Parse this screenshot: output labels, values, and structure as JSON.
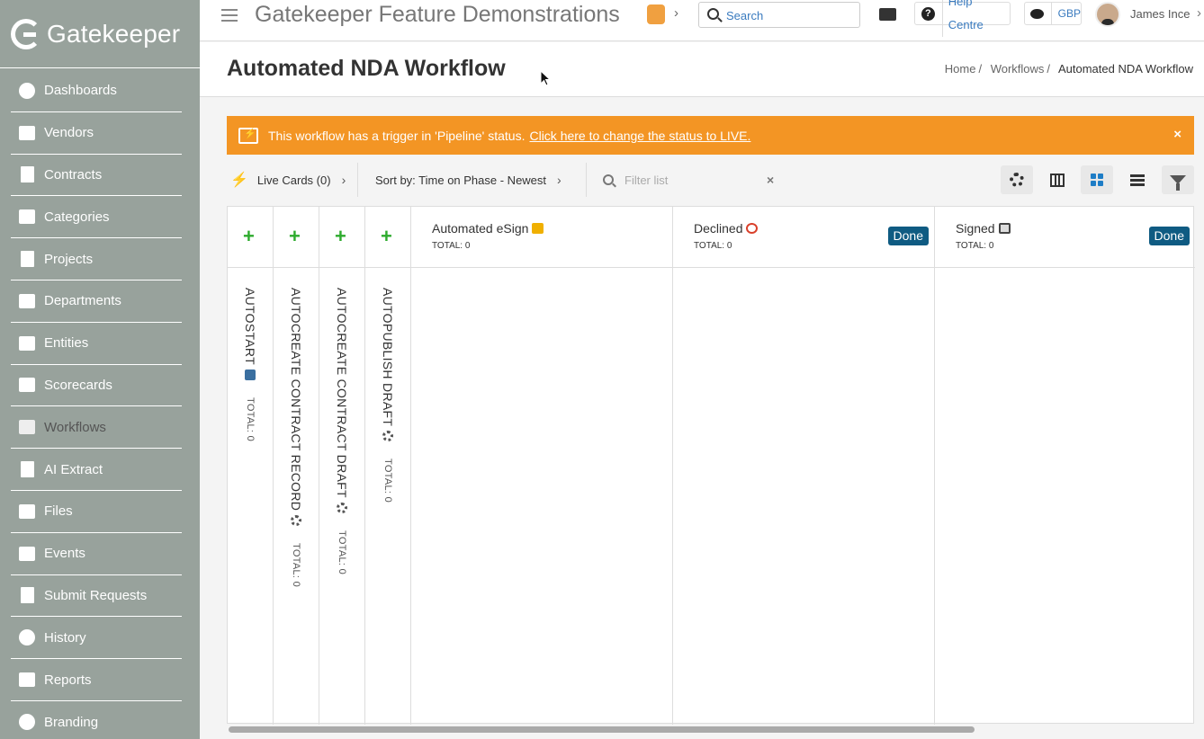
{
  "brand": {
    "name": "Gatekeeper"
  },
  "sidebar": {
    "items": [
      {
        "label": "Dashboards",
        "icon": "dashboard-icon"
      },
      {
        "label": "Vendors",
        "icon": "vendors-icon"
      },
      {
        "label": "Contracts",
        "icon": "contracts-icon"
      },
      {
        "label": "Categories",
        "icon": "categories-icon"
      },
      {
        "label": "Projects",
        "icon": "projects-icon"
      },
      {
        "label": "Departments",
        "icon": "departments-icon"
      },
      {
        "label": "Entities",
        "icon": "entities-icon"
      },
      {
        "label": "Scorecards",
        "icon": "scorecards-icon"
      },
      {
        "label": "Workflows",
        "icon": "workflows-icon"
      },
      {
        "label": "AI Extract",
        "icon": "ai-extract-icon"
      },
      {
        "label": "Files",
        "icon": "files-icon"
      },
      {
        "label": "Events",
        "icon": "events-icon"
      },
      {
        "label": "Submit Requests",
        "icon": "submit-requests-icon"
      },
      {
        "label": "History",
        "icon": "history-icon"
      },
      {
        "label": "Reports",
        "icon": "reports-icon"
      },
      {
        "label": "Branding",
        "icon": "branding-icon"
      }
    ]
  },
  "topbar": {
    "org_title": "Gatekeeper Feature Demonstrations",
    "search_placeholder": "Search",
    "help_label": "Help Centre",
    "currency": "GBP",
    "user_name": "James Ince"
  },
  "page": {
    "title": "Automated NDA Workflow",
    "breadcrumb": [
      "Home",
      "Workflows",
      "Automated NDA Workflow"
    ]
  },
  "banner": {
    "text": "This workflow has a trigger in 'Pipeline' status.",
    "link": "Click here to change the status to LIVE.",
    "close": "×"
  },
  "toolbar": {
    "live_cards": "Live Cards (0)",
    "sort": "Sort by: Time on Phase - Newest",
    "filter_placeholder": "Filter list",
    "filter_clear": "×"
  },
  "lanes": [
    {
      "title": "AUTOSTART",
      "total": "TOTAL: 0",
      "icon": "arrow-box-icon"
    },
    {
      "title": "AUTOCREATE CONTRACT RECORD",
      "total": "TOTAL: 0",
      "icon": "gear-icon"
    },
    {
      "title": "AUTOCREATE CONTRACT DRAFT",
      "total": "TOTAL: 0",
      "icon": "gear-icon"
    },
    {
      "title": "AUTOPUBLISH DRAFT",
      "total": "TOTAL: 0",
      "icon": "gear-icon"
    }
  ],
  "phases": [
    {
      "title": "Automated eSign",
      "total": "TOTAL: 0",
      "icon": "writing-hand-icon",
      "badge": ""
    },
    {
      "title": "Declined",
      "total": "TOTAL: 0",
      "icon": "prohibited-icon",
      "badge": "Done"
    },
    {
      "title": "Signed",
      "total": "TOTAL: 0",
      "icon": "checkbox-icon",
      "badge": "Done"
    }
  ],
  "colors": {
    "sidebar_bg": "#98a29c",
    "banner_bg": "#f39524",
    "done_badge": "#0f5b82",
    "add_plus": "#2eab2e",
    "link_blue": "#3a7bbf"
  }
}
